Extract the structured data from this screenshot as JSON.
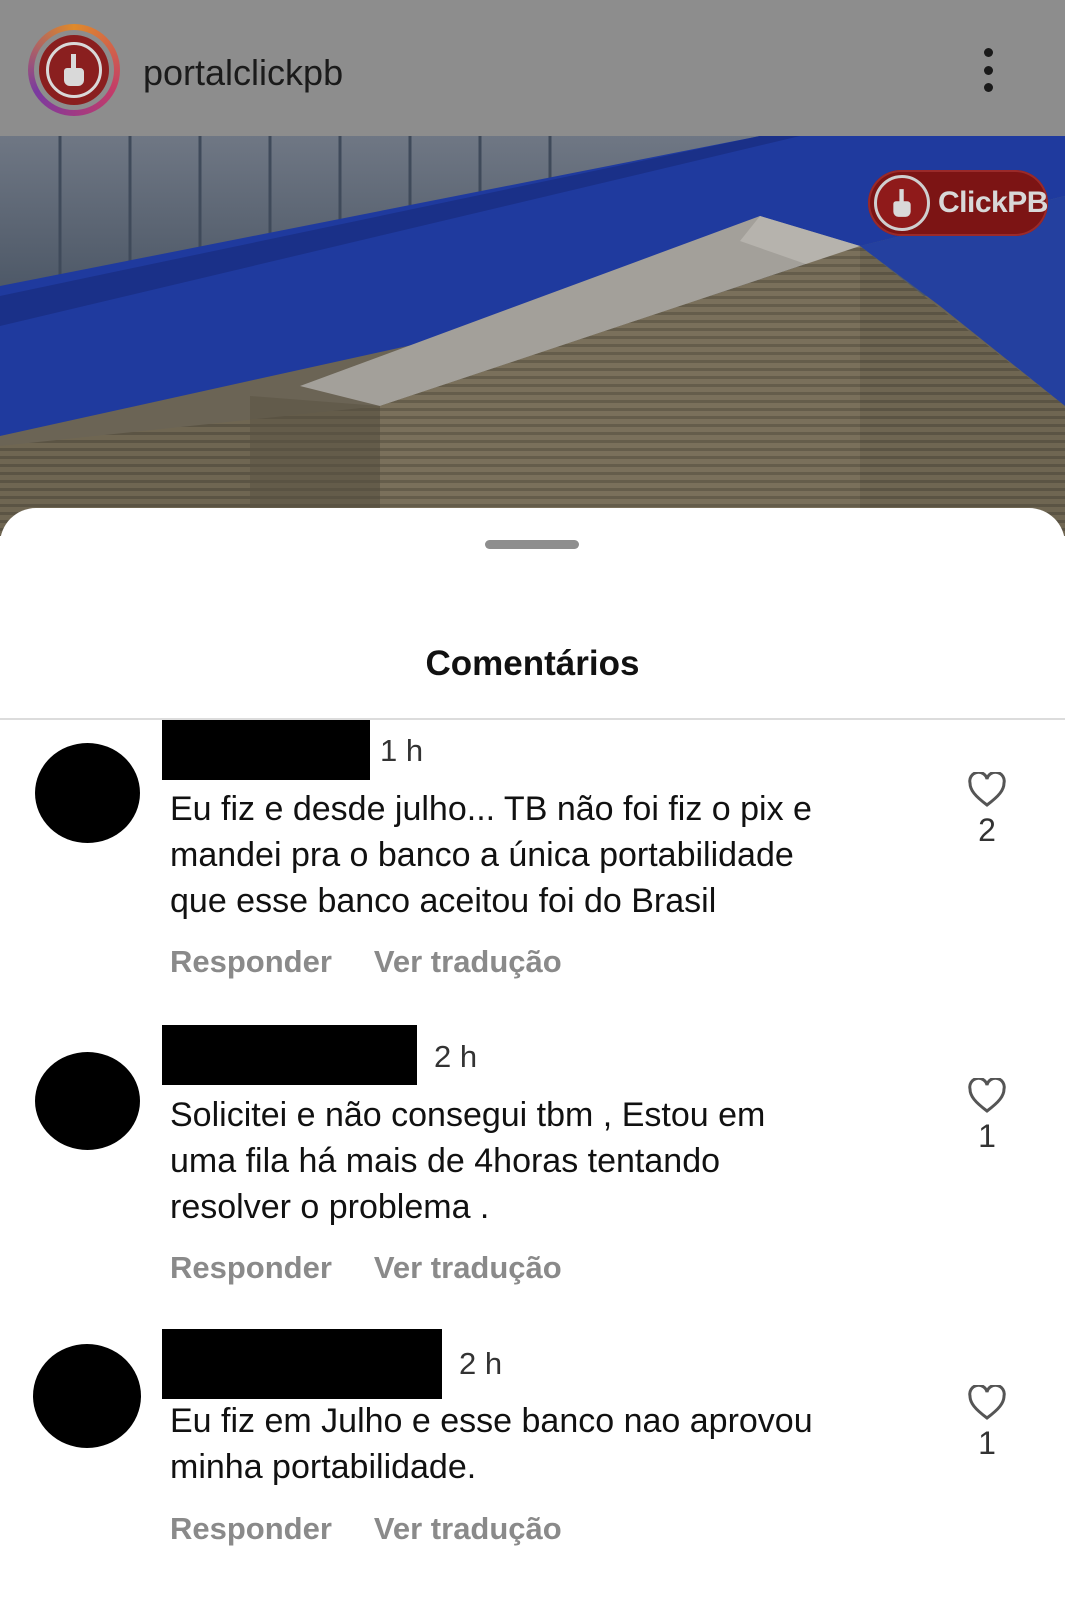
{
  "header": {
    "username": "portalclickpb",
    "more_icon": "more-vertical-icon"
  },
  "post": {
    "badge_text": "ClickPB",
    "colors": {
      "facade_blue": "#1f3a9e",
      "brand_red": "#c01a1a"
    }
  },
  "sheet": {
    "title": "Comentários"
  },
  "comments": [
    {
      "time": "1 h",
      "text_lines": [
        "Eu fiz e desde julho... TB não foi fiz o pix e",
        "mandei pra o banco a única portabilidade",
        "que esse banco aceitou foi do Brasil"
      ],
      "reply_label": "Responder",
      "translate_label": "Ver tradução",
      "likes": "2"
    },
    {
      "time": "2 h",
      "text_lines": [
        "Solicitei e não consegui tbm , Estou em",
        "uma fila há mais de 4horas tentando",
        "resolver o problema ."
      ],
      "reply_label": "Responder",
      "translate_label": "Ver tradução",
      "likes": "1"
    },
    {
      "time": "2 h",
      "text_lines": [
        "Eu fiz em Julho e esse banco nao aprovou",
        "minha portabilidade."
      ],
      "reply_label": "Responder",
      "translate_label": "Ver tradução",
      "likes": "1"
    }
  ]
}
